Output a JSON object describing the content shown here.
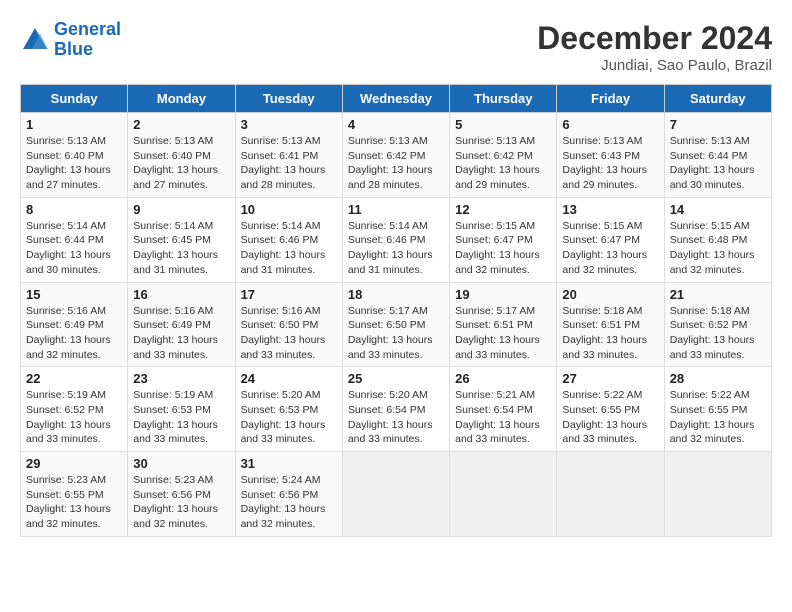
{
  "header": {
    "logo_line1": "General",
    "logo_line2": "Blue",
    "main_title": "December 2024",
    "subtitle": "Jundiai, Sao Paulo, Brazil"
  },
  "days_of_week": [
    "Sunday",
    "Monday",
    "Tuesday",
    "Wednesday",
    "Thursday",
    "Friday",
    "Saturday"
  ],
  "weeks": [
    [
      {
        "day": "1",
        "info": "Sunrise: 5:13 AM\nSunset: 6:40 PM\nDaylight: 13 hours\nand 27 minutes."
      },
      {
        "day": "2",
        "info": "Sunrise: 5:13 AM\nSunset: 6:40 PM\nDaylight: 13 hours\nand 27 minutes."
      },
      {
        "day": "3",
        "info": "Sunrise: 5:13 AM\nSunset: 6:41 PM\nDaylight: 13 hours\nand 28 minutes."
      },
      {
        "day": "4",
        "info": "Sunrise: 5:13 AM\nSunset: 6:42 PM\nDaylight: 13 hours\nand 28 minutes."
      },
      {
        "day": "5",
        "info": "Sunrise: 5:13 AM\nSunset: 6:42 PM\nDaylight: 13 hours\nand 29 minutes."
      },
      {
        "day": "6",
        "info": "Sunrise: 5:13 AM\nSunset: 6:43 PM\nDaylight: 13 hours\nand 29 minutes."
      },
      {
        "day": "7",
        "info": "Sunrise: 5:13 AM\nSunset: 6:44 PM\nDaylight: 13 hours\nand 30 minutes."
      }
    ],
    [
      {
        "day": "8",
        "info": "Sunrise: 5:14 AM\nSunset: 6:44 PM\nDaylight: 13 hours\nand 30 minutes."
      },
      {
        "day": "9",
        "info": "Sunrise: 5:14 AM\nSunset: 6:45 PM\nDaylight: 13 hours\nand 31 minutes."
      },
      {
        "day": "10",
        "info": "Sunrise: 5:14 AM\nSunset: 6:46 PM\nDaylight: 13 hours\nand 31 minutes."
      },
      {
        "day": "11",
        "info": "Sunrise: 5:14 AM\nSunset: 6:46 PM\nDaylight: 13 hours\nand 31 minutes."
      },
      {
        "day": "12",
        "info": "Sunrise: 5:15 AM\nSunset: 6:47 PM\nDaylight: 13 hours\nand 32 minutes."
      },
      {
        "day": "13",
        "info": "Sunrise: 5:15 AM\nSunset: 6:47 PM\nDaylight: 13 hours\nand 32 minutes."
      },
      {
        "day": "14",
        "info": "Sunrise: 5:15 AM\nSunset: 6:48 PM\nDaylight: 13 hours\nand 32 minutes."
      }
    ],
    [
      {
        "day": "15",
        "info": "Sunrise: 5:16 AM\nSunset: 6:49 PM\nDaylight: 13 hours\nand 32 minutes."
      },
      {
        "day": "16",
        "info": "Sunrise: 5:16 AM\nSunset: 6:49 PM\nDaylight: 13 hours\nand 33 minutes."
      },
      {
        "day": "17",
        "info": "Sunrise: 5:16 AM\nSunset: 6:50 PM\nDaylight: 13 hours\nand 33 minutes."
      },
      {
        "day": "18",
        "info": "Sunrise: 5:17 AM\nSunset: 6:50 PM\nDaylight: 13 hours\nand 33 minutes."
      },
      {
        "day": "19",
        "info": "Sunrise: 5:17 AM\nSunset: 6:51 PM\nDaylight: 13 hours\nand 33 minutes."
      },
      {
        "day": "20",
        "info": "Sunrise: 5:18 AM\nSunset: 6:51 PM\nDaylight: 13 hours\nand 33 minutes."
      },
      {
        "day": "21",
        "info": "Sunrise: 5:18 AM\nSunset: 6:52 PM\nDaylight: 13 hours\nand 33 minutes."
      }
    ],
    [
      {
        "day": "22",
        "info": "Sunrise: 5:19 AM\nSunset: 6:52 PM\nDaylight: 13 hours\nand 33 minutes."
      },
      {
        "day": "23",
        "info": "Sunrise: 5:19 AM\nSunset: 6:53 PM\nDaylight: 13 hours\nand 33 minutes."
      },
      {
        "day": "24",
        "info": "Sunrise: 5:20 AM\nSunset: 6:53 PM\nDaylight: 13 hours\nand 33 minutes."
      },
      {
        "day": "25",
        "info": "Sunrise: 5:20 AM\nSunset: 6:54 PM\nDaylight: 13 hours\nand 33 minutes."
      },
      {
        "day": "26",
        "info": "Sunrise: 5:21 AM\nSunset: 6:54 PM\nDaylight: 13 hours\nand 33 minutes."
      },
      {
        "day": "27",
        "info": "Sunrise: 5:22 AM\nSunset: 6:55 PM\nDaylight: 13 hours\nand 33 minutes."
      },
      {
        "day": "28",
        "info": "Sunrise: 5:22 AM\nSunset: 6:55 PM\nDaylight: 13 hours\nand 32 minutes."
      }
    ],
    [
      {
        "day": "29",
        "info": "Sunrise: 5:23 AM\nSunset: 6:55 PM\nDaylight: 13 hours\nand 32 minutes."
      },
      {
        "day": "30",
        "info": "Sunrise: 5:23 AM\nSunset: 6:56 PM\nDaylight: 13 hours\nand 32 minutes."
      },
      {
        "day": "31",
        "info": "Sunrise: 5:24 AM\nSunset: 6:56 PM\nDaylight: 13 hours\nand 32 minutes."
      },
      {
        "day": "",
        "info": ""
      },
      {
        "day": "",
        "info": ""
      },
      {
        "day": "",
        "info": ""
      },
      {
        "day": "",
        "info": ""
      }
    ]
  ]
}
